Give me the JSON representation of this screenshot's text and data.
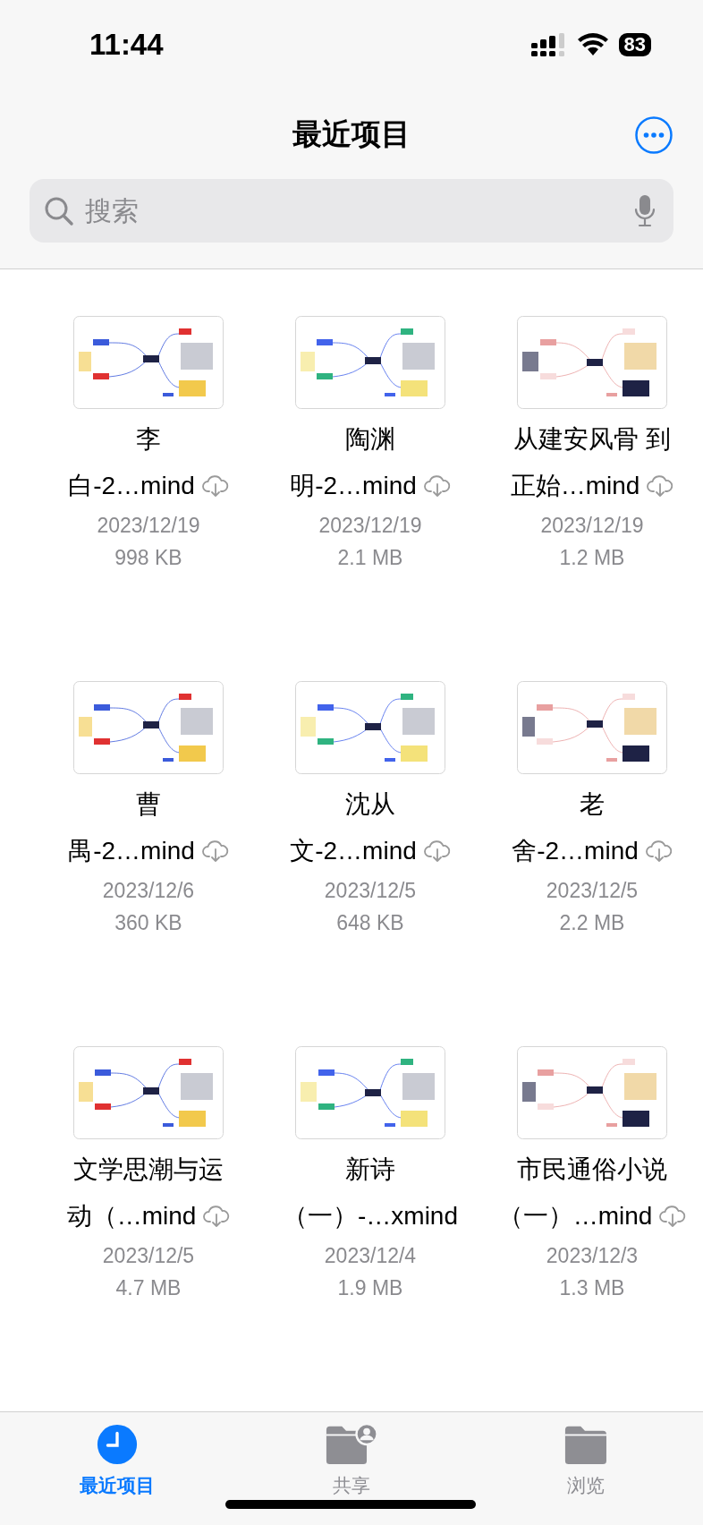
{
  "status_bar": {
    "time": "11:44",
    "battery": "83"
  },
  "header": {
    "title": "最近项目"
  },
  "search": {
    "placeholder": "搜索"
  },
  "files": [
    {
      "name_lines": [
        "李",
        "白-2…mind"
      ],
      "cloud": true,
      "date": "2023/12/19",
      "size": "998 KB"
    },
    {
      "name_lines": [
        "陶渊",
        "明-2…mind"
      ],
      "cloud": true,
      "date": "2023/12/19",
      "size": "2.1 MB"
    },
    {
      "name_lines": [
        "从建安风骨 到",
        "正始…mind"
      ],
      "cloud": true,
      "date": "2023/12/19",
      "size": "1.2 MB"
    },
    {
      "name_lines": [
        "曹",
        "禺-2…mind"
      ],
      "cloud": true,
      "date": "2023/12/6",
      "size": "360 KB"
    },
    {
      "name_lines": [
        "沈从",
        "文-2…mind"
      ],
      "cloud": true,
      "date": "2023/12/5",
      "size": "648 KB"
    },
    {
      "name_lines": [
        "老",
        "舍-2…mind"
      ],
      "cloud": true,
      "date": "2023/12/5",
      "size": "2.2 MB"
    },
    {
      "name_lines": [
        "文学思潮与运",
        "动（…mind"
      ],
      "cloud": true,
      "date": "2023/12/5",
      "size": "4.7 MB"
    },
    {
      "name_lines": [
        "新诗",
        "（一）-…xmind"
      ],
      "cloud": false,
      "date": "2023/12/4",
      "size": "1.9 MB"
    },
    {
      "name_lines": [
        "市民通俗小说",
        "（一）…mind"
      ],
      "cloud": true,
      "date": "2023/12/3",
      "size": "1.3 MB"
    }
  ],
  "tabs": [
    {
      "kind": "recent",
      "label": "最近项目",
      "selected": true
    },
    {
      "kind": "shared",
      "label": "共享",
      "selected": false
    },
    {
      "kind": "browse",
      "label": "浏览",
      "selected": false
    }
  ]
}
